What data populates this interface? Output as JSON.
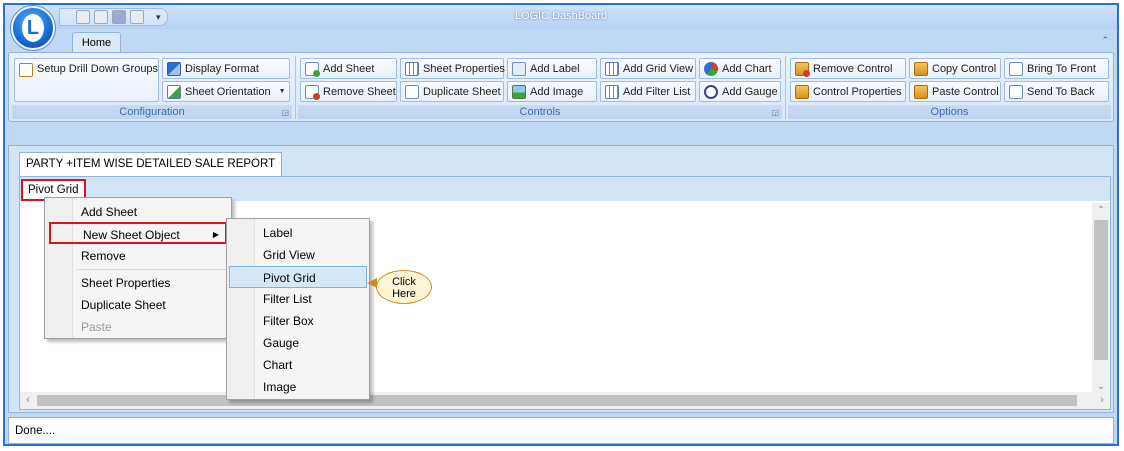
{
  "app": {
    "title": "LOGIC DashBoard",
    "logo_letter": "L"
  },
  "ribbon": {
    "tab_home": "Home",
    "collapse_glyph": "⌃",
    "groups": {
      "configuration": {
        "label": "Configuration",
        "setup_drill_down_groups": "Setup Drill Down Groups",
        "display_format": "Display Format",
        "sheet_orientation": "Sheet Orientation"
      },
      "controls": {
        "label": "Controls",
        "add_sheet": "Add Sheet",
        "remove_sheet": "Remove Sheet",
        "sheet_properties": "Sheet Properties",
        "duplicate_sheet": "Duplicate Sheet",
        "add_label": "Add Label",
        "add_image": "Add Image",
        "add_grid_view": "Add Grid View",
        "add_filter_list": "Add Filter List",
        "add_chart": "Add Chart",
        "add_gauge": "Add Gauge"
      },
      "options": {
        "label": "Options",
        "remove_control": "Remove Control",
        "control_properties": "Control Properties",
        "copy_control": "Copy Control",
        "paste_control": "Paste Control",
        "bring_to_front": "Bring To Front",
        "send_to_back": "Send To Back"
      }
    }
  },
  "document": {
    "sheet_tab": "PARTY +ITEM WISE DETAILED SALE REPORT",
    "pivot_label": "Pivot Grid"
  },
  "context_menu": {
    "items": [
      "Add Sheet",
      "New Sheet Object",
      "Remove",
      "Sheet Properties",
      "Duplicate Sheet",
      "Paste"
    ]
  },
  "submenu": {
    "items": [
      "Label",
      "Grid View",
      "Pivot Grid",
      "Filter List",
      "Filter Box",
      "Gauge",
      "Chart",
      "Image"
    ],
    "selected": "Pivot Grid"
  },
  "callout": {
    "line1": "Click",
    "line2": "Here"
  },
  "status": {
    "text": "Done...."
  },
  "colors": {
    "highlight_red": "#d8141c",
    "window_border": "#2a6fd6",
    "ribbon_bg": "#bfd8f4"
  }
}
